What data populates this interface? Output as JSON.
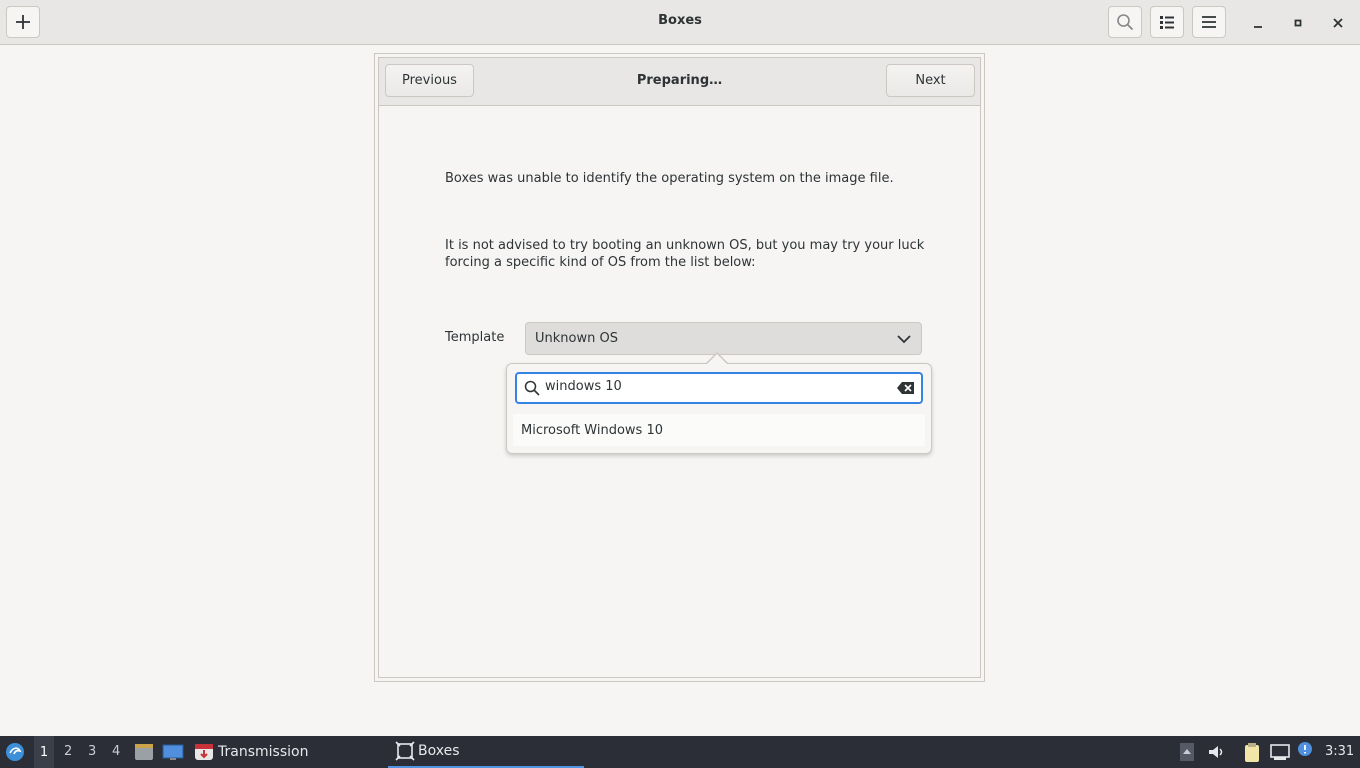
{
  "header": {
    "title": "Boxes",
    "add_icon": "plus-icon",
    "search_icon": "search-icon",
    "view_icon": "list-view-icon",
    "menu_icon": "hamburger-menu-icon"
  },
  "assistant": {
    "title": "Preparing…",
    "previous_label": "Previous",
    "next_label": "Next",
    "message_1": "Boxes was unable to identify the operating system on the image file.",
    "message_2": "It is not advised to try booting an unknown OS, but you may try your luck forcing a specific kind of OS from the list below:",
    "template_label": "Template",
    "template_value": "Unknown OS"
  },
  "popover": {
    "search_value": "windows 10",
    "results": [
      "Microsoft Windows 10"
    ]
  },
  "taskbar": {
    "workspaces": [
      "1",
      "2",
      "3",
      "4"
    ],
    "active_workspace": "1",
    "tasks": [
      {
        "label": "Transmission"
      },
      {
        "label": "Boxes"
      }
    ],
    "clock": "3:31"
  },
  "colors": {
    "accent": "#3584e4",
    "taskbar_bg": "#2b2e37",
    "window_bg": "#f6f5f4"
  }
}
